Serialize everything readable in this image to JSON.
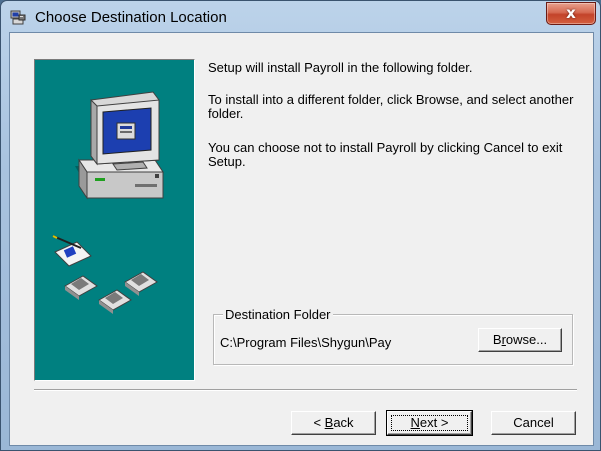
{
  "window": {
    "title": "Choose Destination Location",
    "close_glyph": "x"
  },
  "messages": {
    "line1": "Setup will install Payroll in the following folder.",
    "line2": "To install into a different folder, click Browse, and select another folder.",
    "line3": "You can choose not to install Payroll by clicking Cancel to exit Setup."
  },
  "destination": {
    "group_label": "Destination Folder",
    "path": "C:\\Program Files\\Shygun\\Pay"
  },
  "buttons": {
    "browse": {
      "mnemonic": "r",
      "pre": "B",
      "post": "owse..."
    },
    "back": {
      "prefix": "< ",
      "mnemonic": "B",
      "post": "ack"
    },
    "next": {
      "mnemonic": "N",
      "post": "ext >"
    },
    "cancel": "Cancel"
  },
  "icons": {
    "app": "installer-icon",
    "side": "computer-with-disks-illustration"
  },
  "colors": {
    "side_panel": "#008080",
    "dialog_bg": "#f0f0f0",
    "close_button": "#c3432a"
  }
}
